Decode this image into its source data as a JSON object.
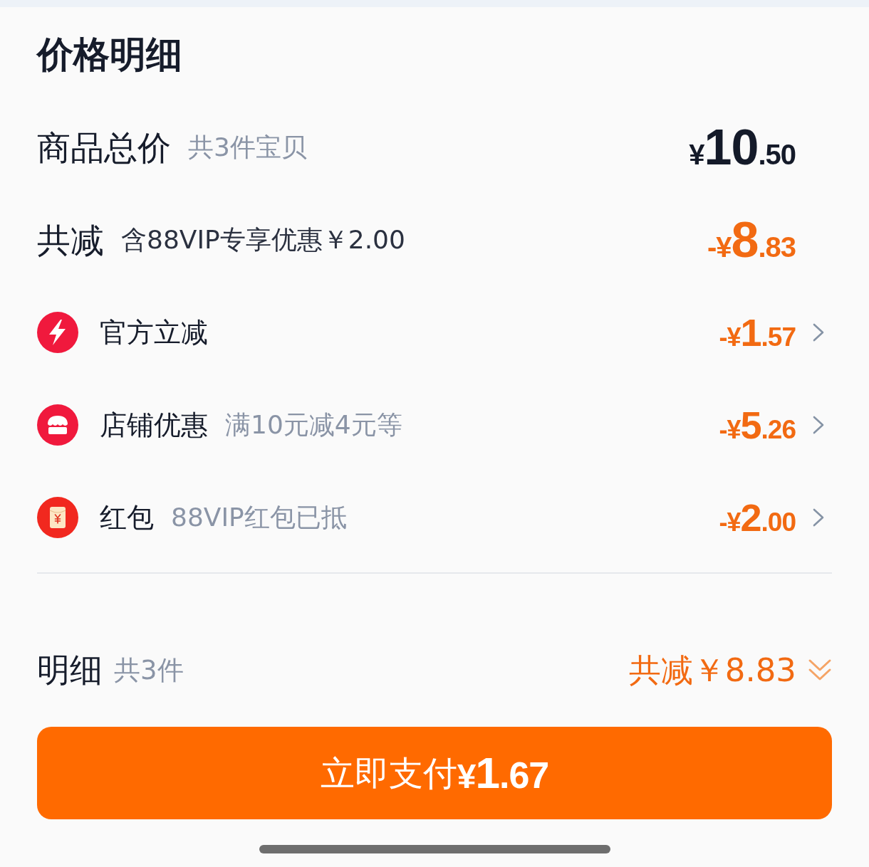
{
  "title": "价格明细",
  "summary": [
    {
      "kind": "total",
      "label": "商品总价",
      "note": "共3件宝贝",
      "amount": {
        "prefix": "¥",
        "major": "10",
        "minor": ".50"
      }
    },
    {
      "kind": "discount",
      "label": "共减",
      "note": "含88VIP专享优惠￥2.00",
      "amount": {
        "prefix": "-¥",
        "major": "8",
        "minor": ".83"
      }
    }
  ],
  "discounts": [
    {
      "kind": "bolt",
      "label": "官方立减",
      "amount": {
        "prefix": "-¥",
        "major": "1",
        "minor": ".57"
      }
    },
    {
      "kind": "store",
      "label": "店铺优惠",
      "note": "满10元减4元等",
      "amount": {
        "prefix": "-¥",
        "major": "5",
        "minor": ".26"
      }
    },
    {
      "kind": "red-packet",
      "label": "红包",
      "note": "88VIP红包已抵",
      "amount": {
        "prefix": "-¥",
        "major": "2",
        "minor": ".00"
      }
    }
  ],
  "footer": {
    "label": "明细",
    "note": "共3件",
    "saving": "共减￥8.83"
  },
  "pay_button": {
    "label": "立即支付",
    "amount": {
      "prefix": "¥",
      "major": "1",
      "minor": ".67"
    }
  }
}
